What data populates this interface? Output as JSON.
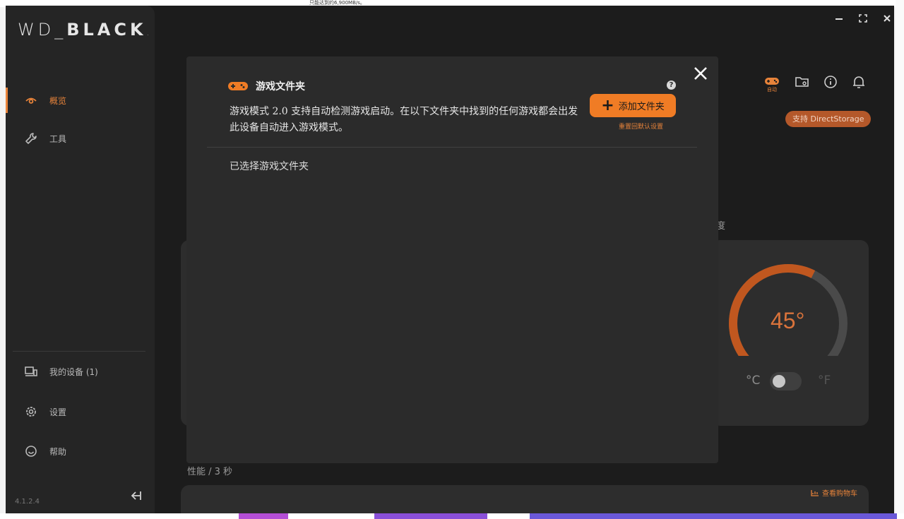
{
  "desktop": {
    "top_text": "只能达到约6,900MB/s。"
  },
  "app": {
    "logo": {
      "prefix": "WD_",
      "brand": "BLACK",
      "suffix": "."
    },
    "version": "4.1.2.4",
    "sidebar": {
      "items": [
        {
          "label": "概览",
          "icon": "eye-icon",
          "active": true
        },
        {
          "label": "工具",
          "icon": "wrench-icon",
          "active": false
        },
        {
          "label": "我的设备 (1)",
          "icon": "devices-icon",
          "active": false
        },
        {
          "label": "设置",
          "icon": "gear-icon",
          "active": false
        },
        {
          "label": "帮助",
          "icon": "help-circle-icon",
          "active": false
        }
      ]
    },
    "toolbar": {
      "auto_label": "自动",
      "icons": [
        "gamepad-icon",
        "folder-icon",
        "info-icon",
        "bell-icon"
      ]
    },
    "directstorage_badge": "支持 DirectStorage",
    "partial_section_label": "度",
    "temperature": {
      "value": "45°",
      "unit_c": "°C",
      "unit_f": "°F",
      "fraction": 0.6
    },
    "performance_label": "性能 / 3 秒",
    "cart_link": "查看购物车"
  },
  "modal": {
    "title": "游戏文件夹",
    "description": "游戏模式 2.0 支持自动检测游戏启动。在以下文件夹中找到的任何游戏都会出发此设备自动进入游戏模式。",
    "add_button": "添加文件夹",
    "reset_link": "重置回默认设置",
    "selected_label": "已选择游戏文件夹"
  },
  "colors": {
    "accent": "#f07c25",
    "bg": "#1c1c1c",
    "panel": "#2b2b2b"
  }
}
